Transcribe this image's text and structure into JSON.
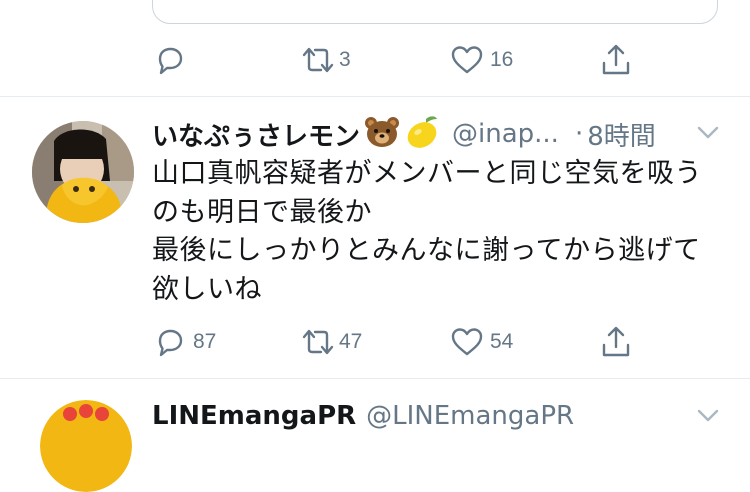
{
  "prev_tweet": {
    "actions": {
      "reply_count": "",
      "retweet_count": "3",
      "like_count": "16"
    }
  },
  "tweet": {
    "display_name": "いなぷぅさレモン",
    "emoji": [
      "bear-emoji",
      "lemon-emoji"
    ],
    "handle": "@inap...",
    "separator": "·",
    "time": "8時間",
    "text_lines": [
      "山口真帆容疑者がメンバーと同じ空気を吸う",
      "のも明日で最後か",
      "最後にしっかりとみんなに謝ってから逃げて",
      "欲しいね"
    ],
    "actions": {
      "reply_count": "87",
      "retweet_count": "47",
      "like_count": "54"
    }
  },
  "next_tweet": {
    "display_name": "LINEmangaPR",
    "handle": "@LINEmangaPR"
  },
  "colors": {
    "secondary_text": "#657786",
    "primary_text": "#14171a",
    "divider": "#e6ecf0",
    "card_border": "#ccd6dd"
  }
}
